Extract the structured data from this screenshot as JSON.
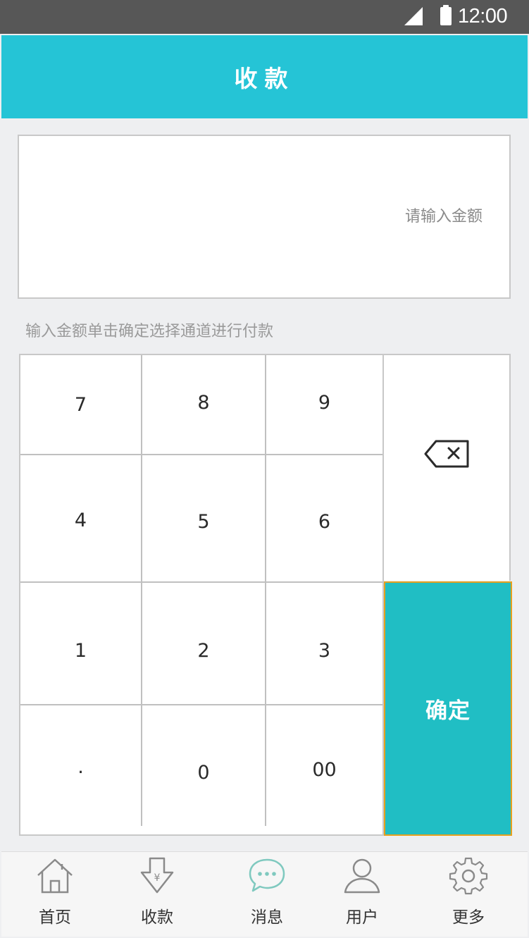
{
  "status_bar": {
    "time": "12:00"
  },
  "header": {
    "title": "收款"
  },
  "amount": {
    "placeholder": "请输入金额",
    "value": ""
  },
  "hint": "输入金额单击确定选择通道进行付款",
  "keypad": {
    "keys": [
      "7",
      "8",
      "9",
      "4",
      "5",
      "6",
      "1",
      "2",
      "3",
      ".",
      "0",
      "00"
    ],
    "confirm_label": "确定",
    "backspace_icon": "backspace-icon"
  },
  "colors": {
    "header": "#25c4d6",
    "confirm": "#20bec4",
    "confirm_border": "#e6a11e",
    "status_bar": "#575757"
  },
  "tabbar": {
    "items": [
      {
        "label": "首页",
        "icon": "home-icon"
      },
      {
        "label": "收款",
        "icon": "collect-payment-icon"
      },
      {
        "label": "消息",
        "icon": "message-icon"
      },
      {
        "label": "用户",
        "icon": "user-icon"
      },
      {
        "label": "更多",
        "icon": "gear-icon"
      }
    ]
  }
}
